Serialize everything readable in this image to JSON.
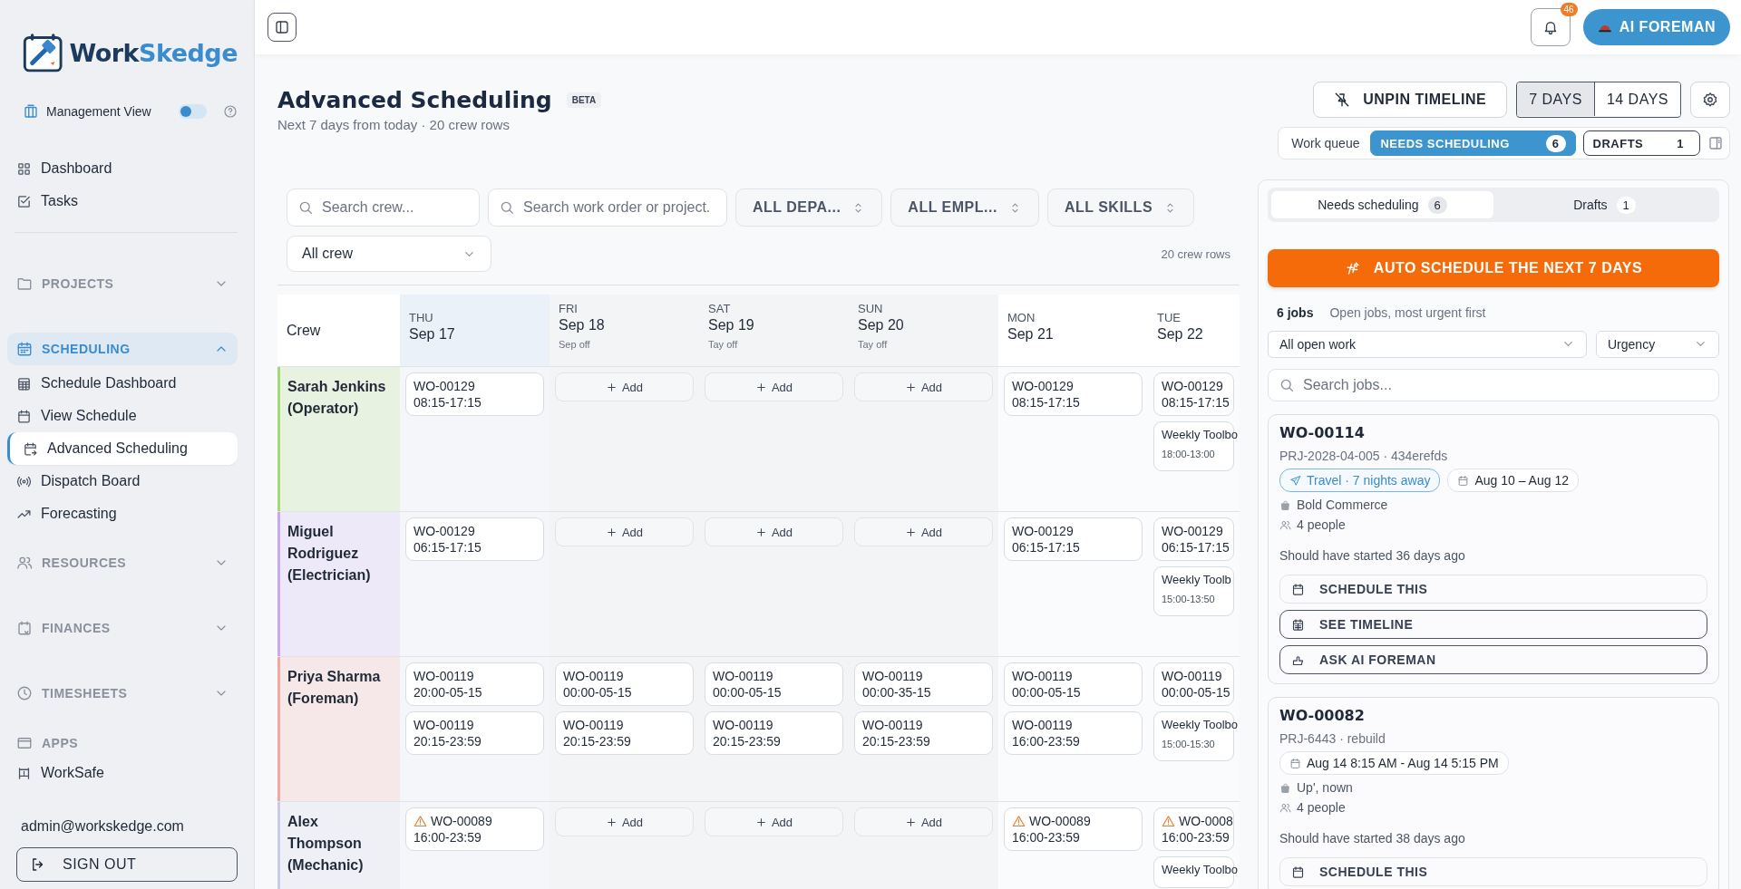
{
  "sidebar": {
    "logo": {
      "part1": "Work",
      "part2": "Skedge"
    },
    "management_view": {
      "label": "Management View",
      "on": false
    },
    "top_links": [
      {
        "label": "Dashboard",
        "selected": false
      },
      {
        "label": "Tasks",
        "selected": false
      }
    ],
    "sections": [
      {
        "label": "PROJECTS",
        "expanded": false
      },
      {
        "label": "SCHEDULING",
        "expanded": true,
        "children": [
          {
            "label": "Schedule Dashboard",
            "selected": false
          },
          {
            "label": "View Schedule",
            "selected": false
          },
          {
            "label": "Advanced Scheduling",
            "selected": true
          },
          {
            "label": "Dispatch Board",
            "selected": false
          },
          {
            "label": "Forecasting",
            "selected": false
          }
        ]
      },
      {
        "label": "RESOURCES",
        "expanded": false
      },
      {
        "label": "FINANCES",
        "expanded": false
      },
      {
        "label": "TIMESHEETS",
        "expanded": false
      }
    ],
    "apps": {
      "label": "APPS",
      "items": [
        {
          "label": "WorkSafe",
          "selected": false
        }
      ]
    },
    "user_email": "admin@workskedge.com",
    "sign_out": "SIGN OUT"
  },
  "topbar": {
    "notifications": "46",
    "ai_button": "AI FOREMAN"
  },
  "header": {
    "title": "Advanced Scheduling",
    "badge": "BETA",
    "subtitle": "Next 7 days from today · 20 crew rows",
    "unpin_button": "UNPIN TIMELINE",
    "range": [
      {
        "label": "7 DAYS",
        "selected": true
      },
      {
        "label": "14 DAYS",
        "selected": false
      }
    ],
    "work_queue": {
      "label": "Work queue",
      "options": [
        {
          "label": "NEEDS SCHEDULING",
          "count": "6",
          "selected": true
        },
        {
          "label": "DRAFTS",
          "count": "1",
          "selected": false
        }
      ]
    }
  },
  "filters": {
    "crew_search": {
      "placeholder": "Search crew..."
    },
    "work_search": {
      "placeholder": "Search work order or project."
    },
    "selects": [
      "ALL DEPA...",
      "ALL EMPL...",
      "ALL SKILLS"
    ],
    "crew_select": "All crew",
    "row_count": "20 crew rows"
  },
  "grid": {
    "crew_heading": "Crew",
    "days": [
      {
        "dow": "THU",
        "date": "Sep 17",
        "today": true,
        "off": false
      },
      {
        "dow": "FRI",
        "date": "Sep 18",
        "note": "Sep off",
        "today": false,
        "off": true
      },
      {
        "dow": "SAT",
        "date": "Sep 19",
        "note": "Tay off",
        "today": false,
        "off": true
      },
      {
        "dow": "SUN",
        "date": "Sep 20",
        "note": "Tay off",
        "today": false,
        "off": true
      },
      {
        "dow": "MON",
        "date": "Sep 21",
        "today": false,
        "off": false
      },
      {
        "dow": "TUE",
        "date": "Sep 22",
        "today": false,
        "off": false
      }
    ],
    "crew": [
      {
        "name": "Sarah Jenkins (Operator)",
        "color": "#a3d977",
        "cells": [
          [
            {
              "kind": "job",
              "code": "WO-00129",
              "time": "08:15-17:15",
              "warning": false
            }
          ],
          [
            {
              "kind": "add",
              "label": "Add"
            }
          ],
          [
            {
              "kind": "add",
              "label": "Add"
            }
          ],
          [
            {
              "kind": "add",
              "label": "Add"
            }
          ],
          [
            {
              "kind": "job",
              "code": "WO-00129",
              "time": "08:15-17:15",
              "warning": false
            }
          ],
          [
            {
              "kind": "job",
              "code": "WO-00129",
              "time": "08:15-17:15",
              "warning": false
            },
            {
              "kind": "event",
              "title": "Weekly Toolbo",
              "time": "18:00-13:00"
            }
          ]
        ]
      },
      {
        "name": "Miguel Rodriguez (Electrician)",
        "color": "#c9a8f0",
        "cells": [
          [
            {
              "kind": "job",
              "code": "WO-00129",
              "time": "06:15-17:15",
              "warning": false
            }
          ],
          [
            {
              "kind": "add",
              "label": "Add"
            }
          ],
          [
            {
              "kind": "add",
              "label": "Add"
            }
          ],
          [
            {
              "kind": "add",
              "label": "Add"
            }
          ],
          [
            {
              "kind": "job",
              "code": "WO-00129",
              "time": "06:15-17:15",
              "warning": false
            }
          ],
          [
            {
              "kind": "job",
              "code": "WO-00129",
              "time": "06:15-17:15",
              "warning": false
            },
            {
              "kind": "event",
              "title": "Weekly Toolb",
              "time": "15:00-13:50"
            }
          ]
        ]
      },
      {
        "name": "Priya Sharma (Foreman)",
        "color": "#f2a7a0",
        "cells": [
          [
            {
              "kind": "job",
              "code": "WO-00119",
              "time": "20:00-05-15",
              "warning": false
            },
            {
              "kind": "job",
              "code": "WO-00119",
              "time": "20:15-23:59",
              "warning": false
            }
          ],
          [
            {
              "kind": "job",
              "code": "WO-00119",
              "time": "00:00-05-15",
              "warning": false
            },
            {
              "kind": "job",
              "code": "WO-00119",
              "time": "20:15-23:59",
              "warning": false
            }
          ],
          [
            {
              "kind": "job",
              "code": "WO-00119",
              "time": "00:00-05-15",
              "warning": false
            },
            {
              "kind": "job",
              "code": "WO-00119",
              "time": "20:15-23:59",
              "warning": false
            }
          ],
          [
            {
              "kind": "job",
              "code": "WO-00119",
              "time": "00:00-35-15",
              "warning": false
            },
            {
              "kind": "job",
              "code": "WO-00119",
              "time": "20:15-23:59",
              "warning": false
            }
          ],
          [
            {
              "kind": "job",
              "code": "WO-00119",
              "time": "00:00-05-15",
              "warning": false
            },
            {
              "kind": "job",
              "code": "WO-00119",
              "time": "16:00-23:59",
              "warning": false
            }
          ],
          [
            {
              "kind": "job",
              "code": "WO-00119",
              "time": "00:00-05-15",
              "warning": false
            },
            {
              "kind": "event",
              "title": "Weekly Toolbo",
              "time": "15:00-15:30"
            }
          ]
        ]
      },
      {
        "name": "Alex Thompson (Mechanic)",
        "color": "#c7cbe8",
        "cells": [
          [
            {
              "kind": "job",
              "code": "WO-00089",
              "time": "16:00-23:59",
              "warning": true
            }
          ],
          [
            {
              "kind": "add",
              "label": "Add"
            }
          ],
          [
            {
              "kind": "add",
              "label": "Add"
            }
          ],
          [
            {
              "kind": "add",
              "label": "Add"
            }
          ],
          [
            {
              "kind": "job",
              "code": "WO-00089",
              "time": "16:00-23:59",
              "warning": true
            }
          ],
          [
            {
              "kind": "job",
              "code": "WO-0008",
              "time": "16:00-23:59",
              "warning": true
            },
            {
              "kind": "event",
              "title": "Weekly Toolbo"
            }
          ]
        ]
      }
    ]
  },
  "queue": {
    "tabs": [
      {
        "label": "Needs scheduling",
        "count": "6",
        "selected": true
      },
      {
        "label": "Drafts",
        "count": "1",
        "selected": false
      }
    ],
    "auto_button": "AUTO SCHEDULE THE NEXT 7 DAYS",
    "job_count": "6 jobs",
    "hint": "Open jobs, most urgent first",
    "filter_select": "All open work",
    "sort_select": "Urgency",
    "search": {
      "placeholder": "Search jobs..."
    },
    "jobs": [
      {
        "code": "WO-00114",
        "project": "PRJ-2028-04-005 · 434erefds",
        "chips": [
          {
            "kind": "travel",
            "label": "Travel · 7 nights away"
          },
          {
            "kind": "date",
            "label": "Aug 10 – Aug 12"
          }
        ],
        "client": "Bold Commerce",
        "people": "4 people",
        "overdue": "Should have started 36 days ago",
        "actions": [
          {
            "kind": "schedule",
            "label": "SCHEDULE THIS"
          },
          {
            "kind": "timeline",
            "label": "SEE TIMELINE"
          },
          {
            "kind": "ai",
            "label": "ASK AI FOREMAN"
          }
        ]
      },
      {
        "code": "WO-00082",
        "project": "PRJ-6443 · rebuild",
        "chips": [
          {
            "kind": "date",
            "label": "Aug 14 8:15 AM - Aug 14 5:15 PM"
          }
        ],
        "client": "Up', nown",
        "people": "4 people",
        "overdue": "Should have started 38 days ago",
        "actions": [
          {
            "kind": "schedule",
            "label": "SCHEDULE THIS"
          }
        ]
      }
    ]
  }
}
